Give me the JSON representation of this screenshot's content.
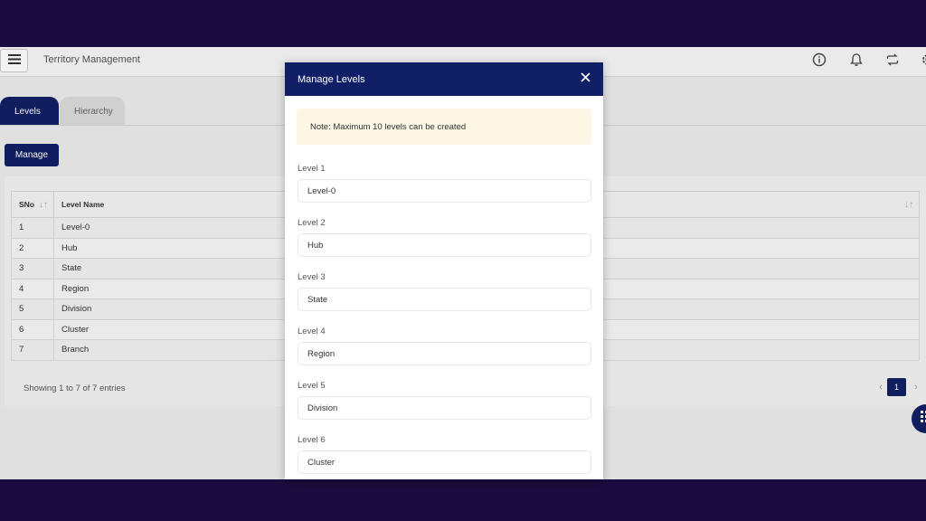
{
  "header": {
    "title": "Territory Management"
  },
  "tabs": [
    {
      "label": "Levels"
    },
    {
      "label": "Hierarchy"
    }
  ],
  "toolbar": {
    "manage_label": "Manage"
  },
  "table": {
    "columns": [
      "SNo",
      "Level Name"
    ],
    "rows": [
      {
        "sno": "1",
        "name": "Level-0"
      },
      {
        "sno": "2",
        "name": "Hub"
      },
      {
        "sno": "3",
        "name": "State"
      },
      {
        "sno": "4",
        "name": "Region"
      },
      {
        "sno": "5",
        "name": "Division"
      },
      {
        "sno": "6",
        "name": "Cluster"
      },
      {
        "sno": "7",
        "name": "Branch"
      }
    ],
    "footer_text": "Showing 1 to 7 of 7 entries",
    "current_page": "1"
  },
  "modal": {
    "title": "Manage Levels",
    "note": "Note: Maximum 10 levels can be created",
    "fields": [
      {
        "label": "Level 1",
        "value": "Level-0"
      },
      {
        "label": "Level 2",
        "value": "Hub"
      },
      {
        "label": "Level 3",
        "value": "State"
      },
      {
        "label": "Level 4",
        "value": "Region"
      },
      {
        "label": "Level 5",
        "value": "Division"
      },
      {
        "label": "Level 6",
        "value": "Cluster"
      }
    ]
  },
  "colors": {
    "primary": "#112066",
    "background": "#1a0c3e",
    "note_bg": "#fdf7e5"
  },
  "icons": [
    "menu-icon",
    "info-icon",
    "bell-icon",
    "sync-icon",
    "settings-icon",
    "close-icon",
    "grid-icon",
    "sort-icon"
  ]
}
